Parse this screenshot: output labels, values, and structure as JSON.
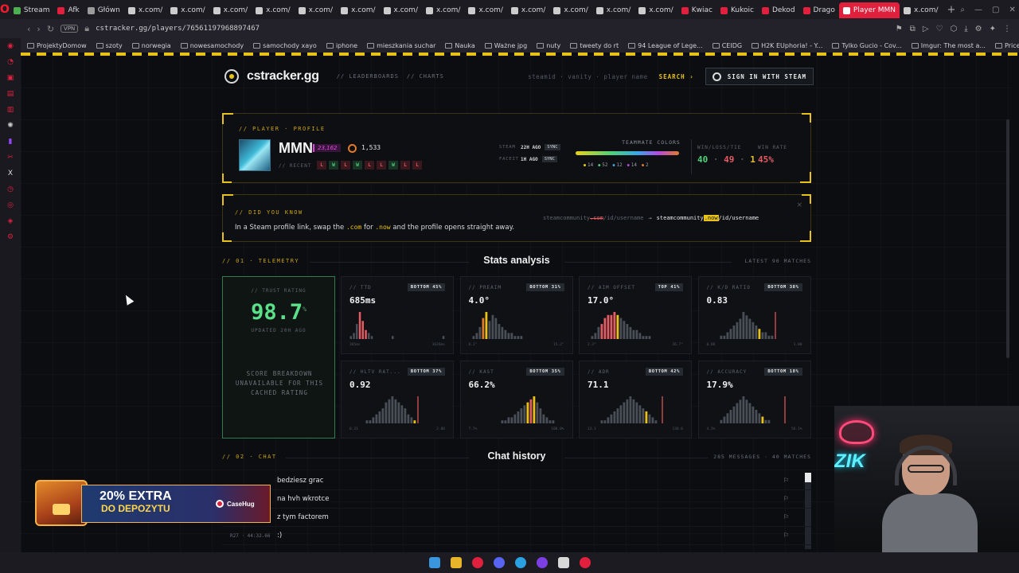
{
  "browser": {
    "tabs": [
      {
        "label": "Stream",
        "color": "#4caf50"
      },
      {
        "label": "Afk",
        "color": "#e0203c"
      },
      {
        "label": "Główn",
        "color": "#9b9b9b"
      },
      {
        "label": "x.com/",
        "color": "#cccccc"
      },
      {
        "label": "x.com/",
        "color": "#cccccc"
      },
      {
        "label": "x.com/",
        "color": "#cccccc"
      },
      {
        "label": "x.com/",
        "color": "#cccccc"
      },
      {
        "label": "x.com/",
        "color": "#cccccc"
      },
      {
        "label": "x.com/",
        "color": "#cccccc"
      },
      {
        "label": "x.com/",
        "color": "#cccccc"
      },
      {
        "label": "x.com/",
        "color": "#cccccc"
      },
      {
        "label": "x.com/",
        "color": "#cccccc"
      },
      {
        "label": "x.com/",
        "color": "#cccccc"
      },
      {
        "label": "x.com/",
        "color": "#cccccc"
      },
      {
        "label": "x.com/",
        "color": "#cccccc"
      },
      {
        "label": "x.com/",
        "color": "#cccccc"
      },
      {
        "label": "Kwiac",
        "color": "#e0203c"
      },
      {
        "label": "Kukoic",
        "color": "#e0203c"
      },
      {
        "label": "Dekod",
        "color": "#e0203c"
      },
      {
        "label": "Drago",
        "color": "#e0203c"
      },
      {
        "label": "Player MMN",
        "color": "#ffffff",
        "active": true
      },
      {
        "label": "x.com/",
        "color": "#cccccc"
      }
    ],
    "vpn_label": "VPN",
    "url": "cstracker.gg/players/76561197968897467",
    "bookmarks": [
      "ProjektyDomow",
      "szoty",
      "norwegia",
      "nowesamochody",
      "samochody xayo",
      "iphone",
      "mieszkania suchar",
      "Nauka",
      "Ważne jpg",
      "nuty",
      "tweety do rt",
      "94 League of Lege...",
      "CEIDG",
      "H2K EUphoria! - Y...",
      "Tylko Gucio - Cov...",
      "Imgur: The most a...",
      "Price history, price..."
    ]
  },
  "site": {
    "logo": "cstracker.gg",
    "nav": [
      "// LEADERBOARDS",
      "// CHARTS"
    ],
    "search_placeholder": "steamid · vanity · player name",
    "search_label": "SEARCH ›",
    "signin_label": "SIGN IN WITH STEAM"
  },
  "profile": {
    "section_label": "// PLAYER · PROFILE",
    "name": "MMN",
    "badge": "23,162",
    "elo": "1,533",
    "recent_label": "// RECENT",
    "recent": [
      "L",
      "W",
      "L",
      "W",
      "L",
      "L",
      "W",
      "L",
      "L"
    ],
    "sync": [
      {
        "key": "STEAM",
        "value": "22H AGO",
        "button": "SYNC"
      },
      {
        "key": "FACEIT",
        "value": "1H AGO",
        "button": "SYNC"
      }
    ],
    "teammate_title": "TEAMMATE COLORS",
    "teammate_counts": [
      "14",
      "52",
      "12",
      "14",
      "2"
    ],
    "wlt_label": "WIN/LOSS/TIE",
    "wins": "40",
    "losses": "49",
    "ties": "1",
    "winrate_label": "WIN RATE",
    "winrate": "45%"
  },
  "did_you_know": {
    "label": "// DID YOU KNOW",
    "text_before": "In a Steam profile link, swap the",
    "code_a": ".com",
    "text_mid": "for",
    "code_b": ".now",
    "text_after": "and the profile opens straight away.",
    "ex_from_a": "steamcommunity",
    "ex_from_b": ".com",
    "ex_from_c": "/id/username",
    "ex_arrow": "→",
    "ex_to_a": "steamcommunity",
    "ex_to_b": ".now",
    "ex_to_c": "/id/username",
    "close": "×"
  },
  "telemetry": {
    "label": "// 01 · TELEMETRY",
    "title": "Stats analysis",
    "right": "LATEST 90 MATCHES",
    "trust": {
      "label": "// TRUST RATING",
      "value": "98.7",
      "unit": "%",
      "updated": "UPDATED 20H AGO",
      "note": "SCORE BREAKDOWN UNAVAILABLE FOR THIS CACHED RATING"
    },
    "metrics": [
      {
        "label": "// TTD",
        "tag": "BOTTOM 45%",
        "value": "685ms",
        "min": "365ms",
        "max": "3626ms",
        "bars": [
          1,
          2,
          5,
          9,
          6,
          3,
          2,
          1,
          0,
          0,
          0,
          0,
          0,
          0,
          1,
          0,
          0,
          0,
          0,
          0,
          0,
          0,
          0,
          0,
          0,
          0,
          0,
          0,
          0,
          0,
          0,
          1
        ],
        "red": [
          3,
          4,
          5
        ],
        "yellow": [],
        "accent": "#e55b62"
      },
      {
        "label": "// PREAIM",
        "tag": "BOTTOM 31%",
        "value": "4.0°",
        "min": "0.1°",
        "max": "15.2°",
        "bars": [
          0,
          1,
          2,
          4,
          7,
          9,
          6,
          8,
          7,
          5,
          4,
          3,
          2,
          2,
          1,
          1,
          1,
          0,
          0,
          0,
          0,
          0,
          0,
          0,
          0,
          0,
          0,
          0,
          0,
          0
        ],
        "red": [
          4,
          5
        ],
        "yellow": [
          5
        ],
        "accent": "#e07b2a"
      },
      {
        "label": "// AIM OFFSET",
        "tag": "TOP 41%",
        "value": "17.0°",
        "min": "2.3°",
        "max": "26.7°",
        "bars": [
          0,
          1,
          2,
          4,
          5,
          7,
          8,
          8,
          9,
          8,
          7,
          6,
          5,
          4,
          3,
          3,
          2,
          1,
          1,
          1,
          0,
          0,
          0,
          0,
          0,
          0,
          0,
          0,
          0,
          0
        ],
        "red": [
          4,
          5,
          6,
          7,
          8
        ],
        "yellow": [
          9
        ],
        "accent": "#e55b62"
      },
      {
        "label": "// K/D RATIO",
        "tag": "BOTTOM 38%",
        "value": "0.83",
        "min": "0.08",
        "max": "3.00",
        "bars": [
          0,
          0,
          0,
          0,
          1,
          1,
          2,
          3,
          4,
          5,
          6,
          8,
          7,
          6,
          5,
          4,
          3,
          2,
          2,
          1,
          1,
          0,
          0,
          0,
          0,
          0,
          0,
          0,
          0,
          0
        ],
        "red": [
          21
        ],
        "yellow": [
          16
        ],
        "accent": "#e55b62"
      },
      {
        "label": "// HLTV RAT...",
        "tag": "BOTTOM 37%",
        "value": "0.92",
        "min": "0.31",
        "max": "2.00",
        "bars": [
          0,
          0,
          0,
          0,
          0,
          1,
          1,
          2,
          3,
          4,
          5,
          7,
          8,
          9,
          8,
          7,
          6,
          5,
          3,
          2,
          1,
          0,
          0,
          0,
          0,
          0,
          0,
          0,
          0,
          0
        ],
        "red": [
          21
        ],
        "yellow": [
          20
        ],
        "accent": "#e55b62"
      },
      {
        "label": "// KAST",
        "tag": "BOTTOM 35%",
        "value": "66.2%",
        "min": "7.7%",
        "max": "100.0%",
        "bars": [
          0,
          0,
          0,
          0,
          0,
          0,
          0,
          0,
          0,
          0,
          1,
          1,
          2,
          2,
          3,
          4,
          5,
          6,
          7,
          8,
          9,
          7,
          5,
          3,
          2,
          1,
          1,
          0,
          0,
          0
        ],
        "red": [
          19
        ],
        "yellow": [
          18,
          20
        ],
        "accent": "#e55b62"
      },
      {
        "label": "// ADR",
        "tag": "BOTTOM 42%",
        "value": "71.1",
        "min": "13.1",
        "max": "130.0",
        "bars": [
          0,
          0,
          0,
          0,
          1,
          1,
          2,
          3,
          4,
          5,
          6,
          7,
          8,
          9,
          8,
          7,
          6,
          5,
          4,
          3,
          2,
          1,
          0,
          0,
          0,
          0,
          0,
          0,
          0,
          0
        ],
        "red": [
          23
        ],
        "yellow": [
          18
        ],
        "accent": "#e55b62"
      },
      {
        "label": "// ACCURACY",
        "tag": "BOTTOM 18%",
        "value": "17.9%",
        "min": "4.3%",
        "max": "56.1%",
        "bars": [
          0,
          0,
          0,
          0,
          1,
          2,
          3,
          4,
          5,
          6,
          7,
          8,
          7,
          6,
          5,
          4,
          3,
          2,
          1,
          1,
          0,
          0,
          0,
          0,
          0,
          0,
          0,
          0,
          0,
          0
        ],
        "red": [
          24
        ],
        "yellow": [
          17
        ],
        "accent": "#e55b62"
      }
    ]
  },
  "chat": {
    "label": "// 02 · CHAT",
    "title": "Chat history",
    "right": "285 MESSAGES · 40 MATCHES",
    "messages": [
      {
        "text": "bedziesz grac",
        "stamp": ""
      },
      {
        "text": "na hvh wkrotce",
        "stamp": ""
      },
      {
        "text": "z tym factorem",
        "stamp": ""
      },
      {
        "text": ":)",
        "stamp": "R27 · 44:32.66"
      }
    ],
    "flag": "⚐"
  },
  "promo": {
    "line1": "20% EXTRA",
    "line2": "DO DEPOZYTU",
    "brand": "CaseHug"
  },
  "stream": {
    "neon_text": "ZIK"
  }
}
